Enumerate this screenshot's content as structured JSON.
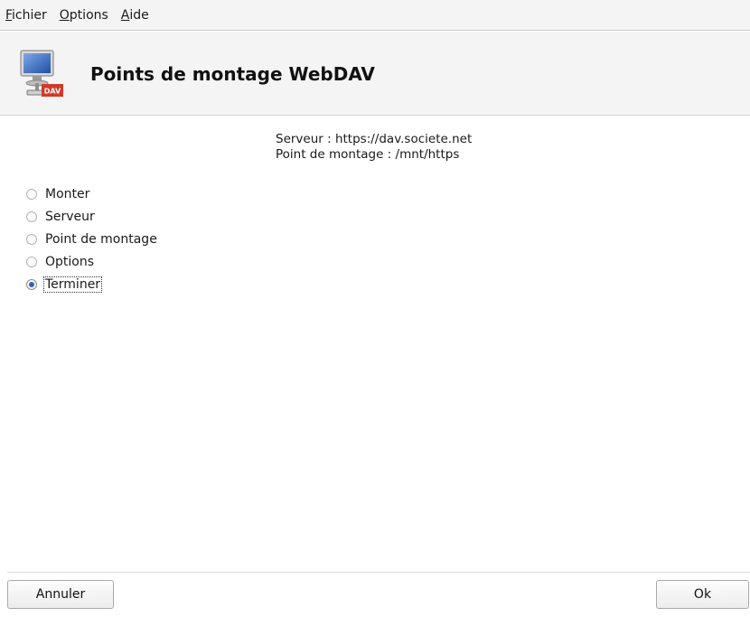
{
  "menubar": {
    "items": [
      {
        "accel": "F",
        "rest": "ichier"
      },
      {
        "accel": "O",
        "rest": "ptions"
      },
      {
        "accel": "A",
        "rest": "ide"
      }
    ]
  },
  "header": {
    "title": "Points de montage WebDAV",
    "icon": "network-drive-dav-icon",
    "icon_badge": "DAV"
  },
  "info": {
    "server_line": "Serveur : https://dav.societe.net",
    "mount_line": "Point de montage : /mnt/https"
  },
  "options": [
    {
      "label": "Monter",
      "checked": false
    },
    {
      "label": "Serveur",
      "checked": false
    },
    {
      "label": "Point de montage",
      "checked": false
    },
    {
      "label": "Options",
      "checked": false
    },
    {
      "label": "Terminer",
      "checked": true
    }
  ],
  "buttons": {
    "cancel": "Annuler",
    "ok": "Ok"
  },
  "colors": {
    "accent": "#3462b8",
    "badge": "#d03a2a"
  }
}
